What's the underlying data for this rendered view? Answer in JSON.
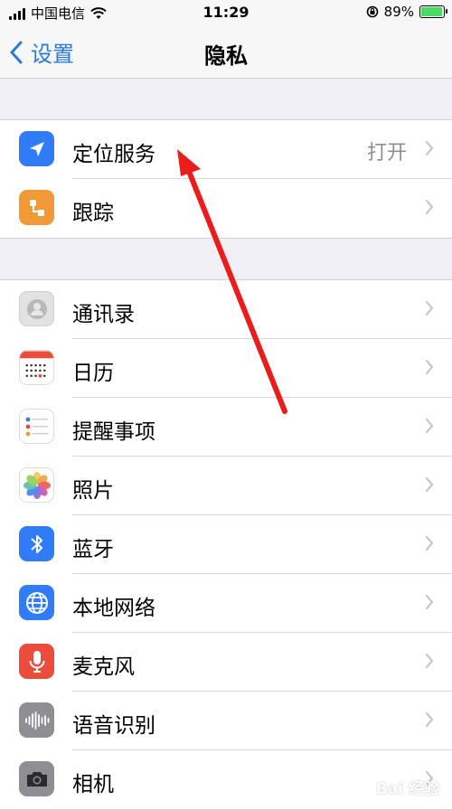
{
  "status_bar": {
    "carrier": "中国电信",
    "time": "11:29",
    "battery_percent": "89%",
    "battery_level": 0.89
  },
  "nav": {
    "back_label": "设置",
    "title": "隐私"
  },
  "group1": [
    {
      "label": "定位服务",
      "value": "打开",
      "icon": "location-arrow-icon",
      "color": "#2f7cf6"
    },
    {
      "label": "跟踪",
      "value": "",
      "icon": "tracking-icon",
      "color": "#f09a37"
    }
  ],
  "group2": [
    {
      "label": "通讯录",
      "icon": "contacts-icon",
      "color": "#e8e8e8"
    },
    {
      "label": "日历",
      "icon": "calendar-icon",
      "color": "#ffffff"
    },
    {
      "label": "提醒事项",
      "icon": "reminders-icon",
      "color": "#ffffff"
    },
    {
      "label": "照片",
      "icon": "photos-icon",
      "color": "#ffffff"
    },
    {
      "label": "蓝牙",
      "icon": "bluetooth-icon",
      "color": "#2f7cf6"
    },
    {
      "label": "本地网络",
      "icon": "globe-icon",
      "color": "#2f7cf6"
    },
    {
      "label": "麦克风",
      "icon": "microphone-icon",
      "color": "#eb4d3d"
    },
    {
      "label": "语音识别",
      "icon": "waveform-icon",
      "color": "#8e8e93"
    },
    {
      "label": "相机",
      "icon": "camera-icon",
      "color": "#8e8e93"
    }
  ],
  "watermark": "Bai 经验"
}
